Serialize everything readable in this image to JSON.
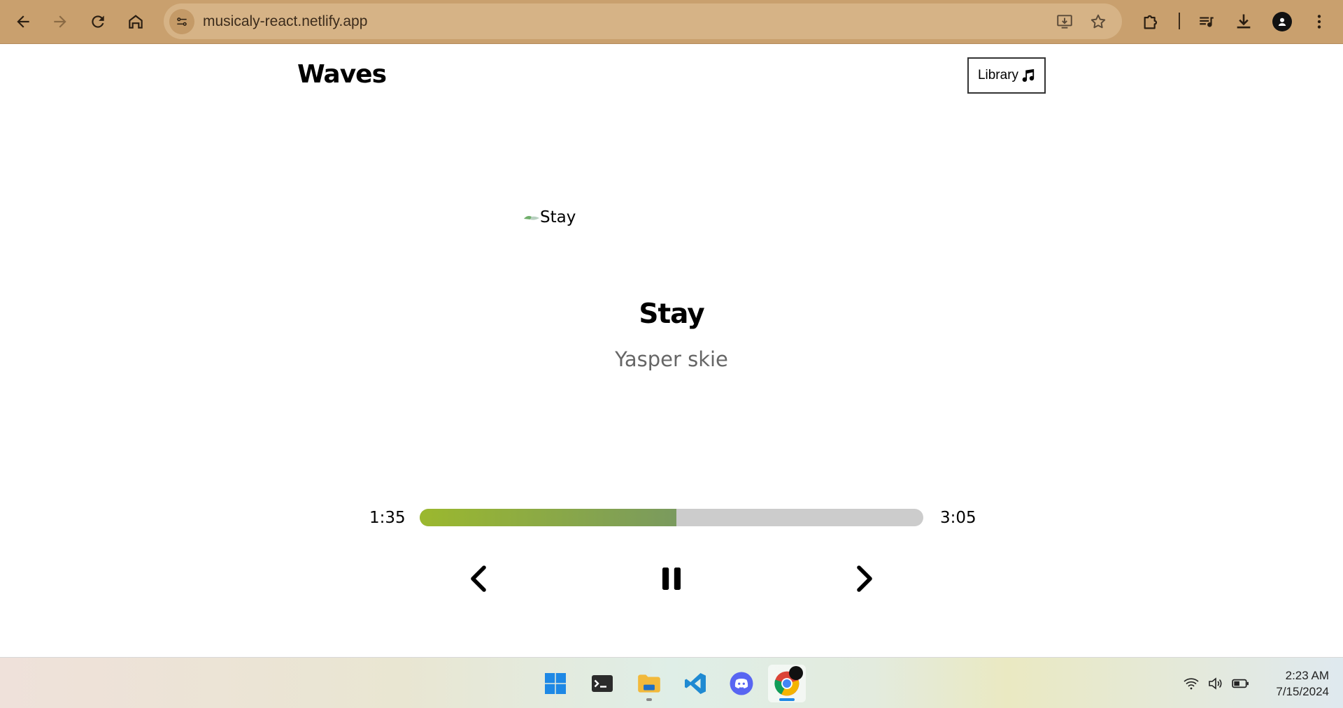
{
  "browser": {
    "url": "musicaly-react.netlify.app"
  },
  "app": {
    "brand": "Waves",
    "library_label": "Library",
    "cover_alt": "Stay",
    "song": {
      "title": "Stay",
      "artist": "Yasper skie"
    },
    "player": {
      "current_time": "1:35",
      "duration": "3:05",
      "progress_fraction": 0.51,
      "state": "playing"
    },
    "colors": {
      "progress_start": "#9bb82e",
      "progress_end": "#7a9a5e",
      "track": "#cccccc"
    }
  },
  "taskbar": {
    "apps": [
      {
        "name": "start",
        "icon": "windows-icon"
      },
      {
        "name": "terminal",
        "icon": "terminal-icon"
      },
      {
        "name": "file-explorer",
        "icon": "folder-icon"
      },
      {
        "name": "vscode",
        "icon": "vscode-icon"
      },
      {
        "name": "discord",
        "icon": "discord-icon"
      },
      {
        "name": "chrome",
        "icon": "chrome-icon"
      }
    ],
    "clock": {
      "time": "2:23 AM",
      "date": "7/15/2024"
    }
  }
}
